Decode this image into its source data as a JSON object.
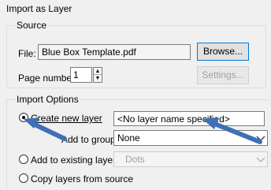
{
  "window": {
    "title": "Import as Layer"
  },
  "source": {
    "legend": "Source",
    "file_label": "File:",
    "file_value": "Blue Box Template.pdf",
    "browse_label": "Browse...",
    "page_number_label": "Page number:",
    "page_number_value": "1",
    "settings_label": "Settings..."
  },
  "import_options": {
    "legend": "Import Options",
    "create_new_layer_label": "Create new layer",
    "layer_name_value": "<No layer name specified>",
    "add_to_group_label": "Add to group:",
    "group_value": "None",
    "add_to_existing_label": "Add to existing layer",
    "existing_layer_value": "Dots",
    "copy_layers_label": "Copy layers from source"
  },
  "colors": {
    "arrow": "#3f6fb5"
  }
}
